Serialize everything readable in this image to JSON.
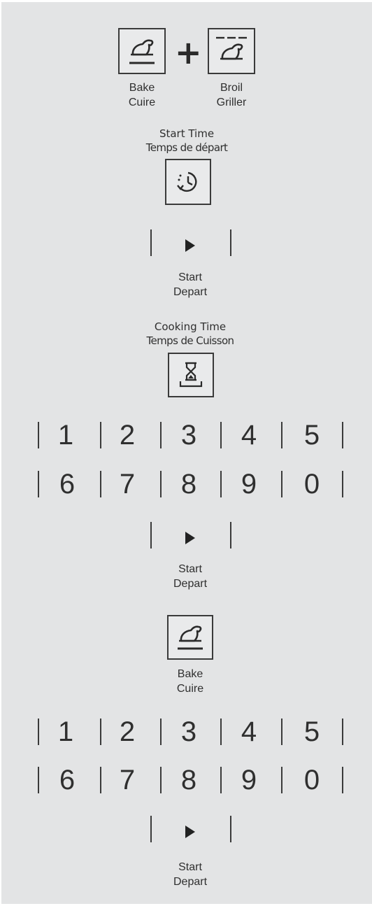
{
  "combo": {
    "bake_label_en": "Bake",
    "bake_label_fr": "Cuire",
    "plus_symbol": "+",
    "broil_label_en": "Broil",
    "broil_label_fr": "Griller"
  },
  "start_time": {
    "label_en": "Start Time",
    "label_fr": "Temps de départ",
    "icon": "clock-delay-icon"
  },
  "start_1": {
    "icon": "play-icon",
    "label_en": "Start",
    "label_fr": "Depart"
  },
  "cooking_time": {
    "label_en": "Cooking Time",
    "label_fr": "Temps de Cuisson",
    "icon": "hourglass-icon"
  },
  "keypad_1": {
    "row1": [
      "1",
      "2",
      "3",
      "4",
      "5"
    ],
    "row2": [
      "6",
      "7",
      "8",
      "9",
      "0"
    ]
  },
  "start_2": {
    "icon": "play-icon",
    "label_en": "Start",
    "label_fr": "Depart"
  },
  "bake": {
    "icon": "bake-icon",
    "label_en": "Bake",
    "label_fr": "Cuire"
  },
  "keypad_2": {
    "row1": [
      "1",
      "2",
      "3",
      "4",
      "5"
    ],
    "row2": [
      "6",
      "7",
      "8",
      "9",
      "0"
    ]
  },
  "start_3": {
    "icon": "play-icon",
    "label_en": "Start",
    "label_fr": "Depart"
  },
  "colors": {
    "panel": "#e3e4e5",
    "ink": "#2a2a2a"
  }
}
